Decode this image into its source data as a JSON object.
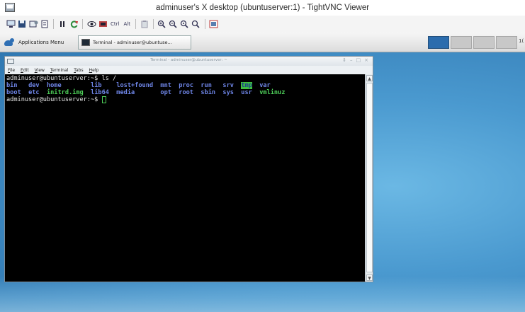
{
  "window": {
    "title": "adminuser's X desktop (ubuntuserver:1) - TightVNC Viewer"
  },
  "toolbar": {
    "ctrl_label": "Ctrl",
    "alt_label": "Alt",
    "icons": [
      "new-connection-icon",
      "save-icon",
      "options-icon",
      "info-icon",
      "pause-icon",
      "refresh-icon",
      "ctrl-alt-del-icon",
      "ctrl-esc-icon",
      "ctrl-key-icon",
      "alt-key-icon",
      "clipboard-icon",
      "zoom-in-icon",
      "zoom-out-icon",
      "zoom-100-icon",
      "zoom-fit-icon",
      "fullscreen-icon"
    ]
  },
  "taskbar": {
    "applications_menu": "Applications Menu",
    "task_button": "Terminal - adminuser@ubuntuse...",
    "clock": "1("
  },
  "terminal": {
    "title": "Terminal - adminuser@ubuntuserver: ~",
    "menu": [
      "File",
      "Edit",
      "View",
      "Terminal",
      "Tabs",
      "Help"
    ],
    "line1": "adminuser@ubuntuserver:~$ ls /",
    "ls_row1": [
      "bin",
      "dev",
      "home",
      "lib",
      "lost+found",
      "mnt",
      "proc",
      "run",
      "srv",
      "tmp",
      "var"
    ],
    "ls_row2": [
      "boot",
      "etc",
      "initrd.img",
      "lib64",
      "media",
      "opt",
      "root",
      "sbin",
      "sys",
      "usr",
      "vmlinuz"
    ],
    "prompt": "adminuser@ubuntuserver:~$ "
  },
  "colors": {
    "directory": "#6f86e8",
    "symlink": "#4fd15a",
    "sticky_dir_bg": "#3fbf3f",
    "desktop": "#4a99cf"
  }
}
